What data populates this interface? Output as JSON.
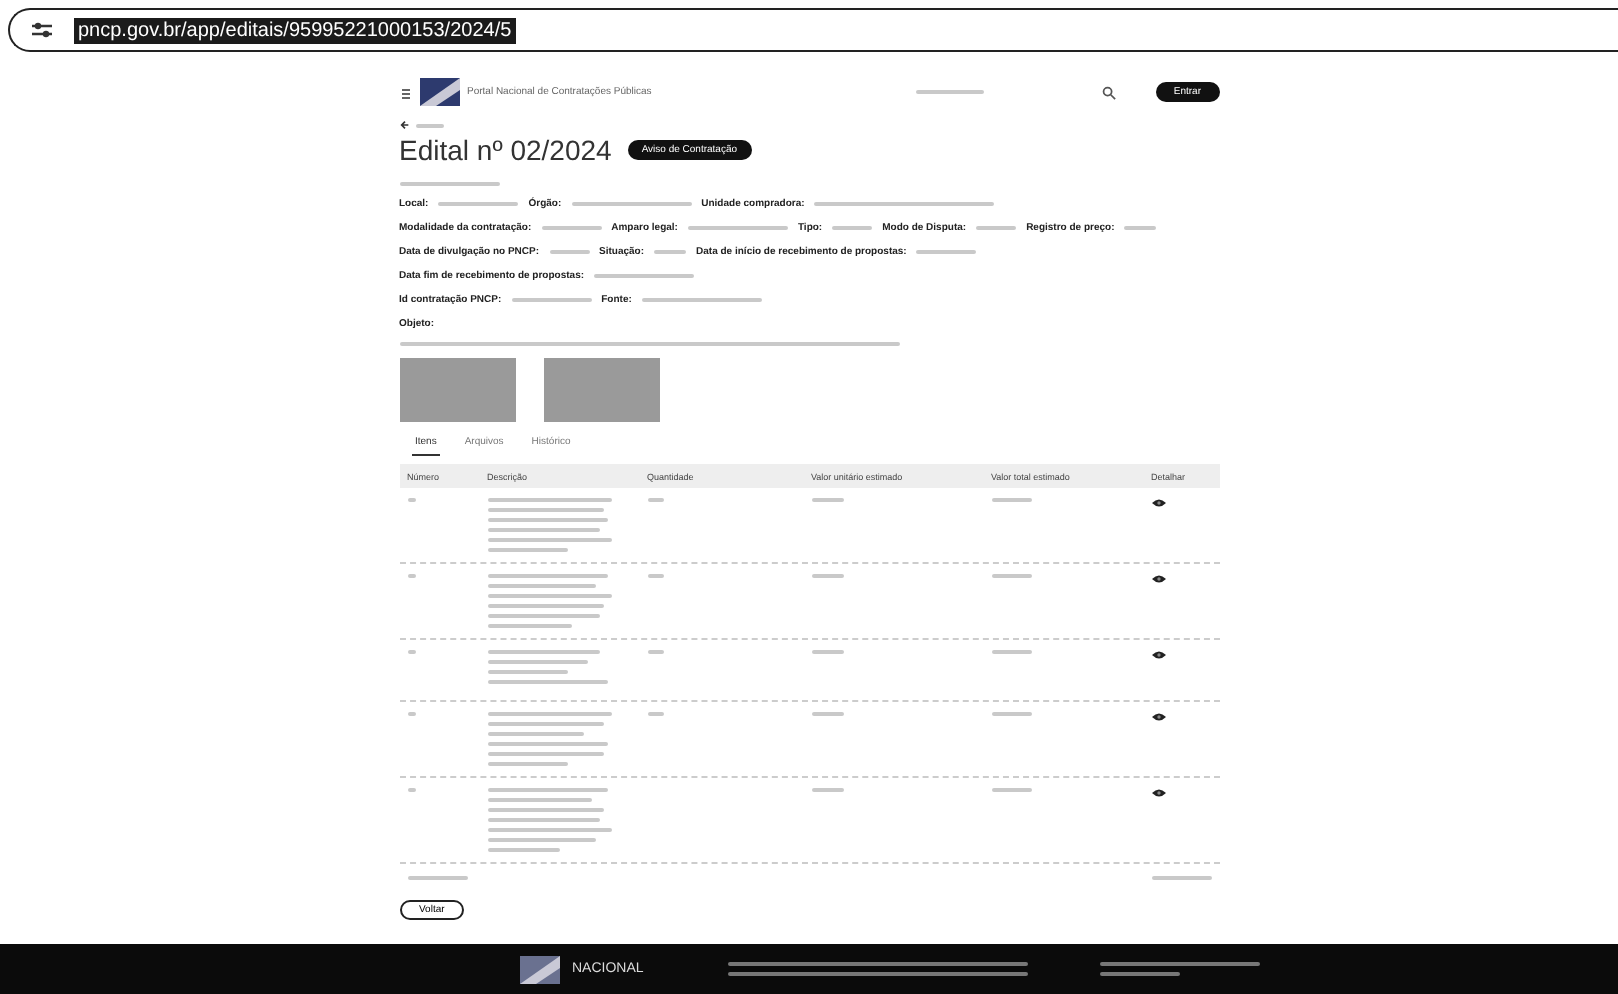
{
  "address_bar": {
    "url": "pncp.gov.br/app/editais/95995221000153/2024/5"
  },
  "header": {
    "site_name": "Portal Nacional de Contratações Públicas",
    "login_button": "Entrar"
  },
  "title": "Edital nº 02/2024",
  "badge": "Aviso de Contratação",
  "field_rows": [
    [
      {
        "label": "Local:"
      },
      {
        "label": "Órgão:"
      },
      {
        "label": "Unidade compradora:"
      }
    ],
    [
      {
        "label": "Modalidade da contratação:"
      },
      {
        "label": "Amparo legal:"
      },
      {
        "label": "Tipo:"
      },
      {
        "label": "Modo de Disputa:"
      },
      {
        "label": "Registro de preço:"
      }
    ],
    [
      {
        "label": "Data de divulgação no PNCP:"
      },
      {
        "label": "Situação:"
      },
      {
        "label": "Data de início de recebimento de propostas:"
      }
    ],
    [
      {
        "label": "Data fim de recebimento de propostas:"
      }
    ],
    [
      {
        "label": "Id contratação PNCP:"
      },
      {
        "label": "Fonte:"
      }
    ]
  ],
  "object_label": "Objeto:",
  "tabs": [
    {
      "label": "Itens",
      "selected": true
    },
    {
      "label": "Arquivos",
      "selected": false
    },
    {
      "label": "Histórico",
      "selected": false
    }
  ],
  "table": {
    "columns": [
      "Número",
      "Descrição",
      "Quantidade",
      "Valor unitário estimado",
      "Valor total estimado",
      "Detalhar"
    ]
  },
  "back_button": "Voltar",
  "footer": {
    "logo_text": "NACIONAL"
  }
}
